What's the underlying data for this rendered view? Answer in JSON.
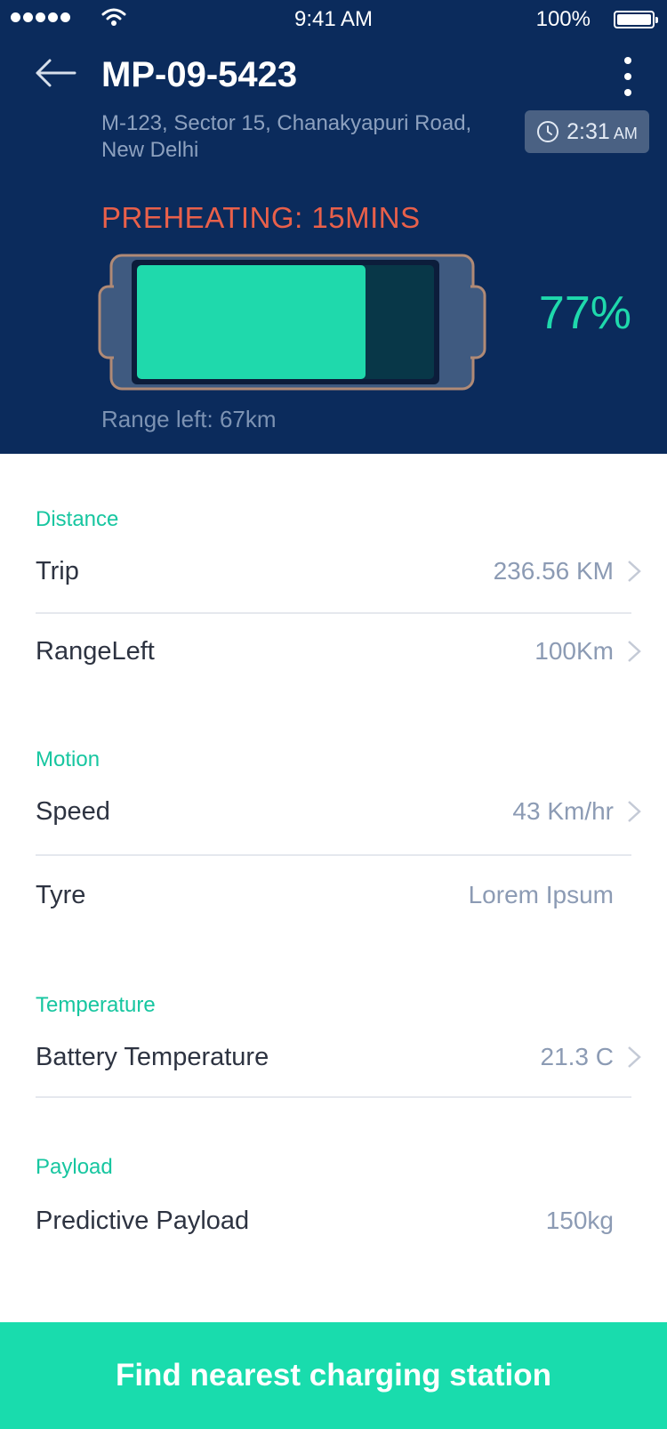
{
  "status_bar": {
    "time": "9:41 AM",
    "battery": "100%"
  },
  "header": {
    "vehicle_id": "MP-09-5423",
    "address": "M-123, Sector 15, Chanakyapuri Road, New Delhi",
    "time_chip": {
      "time": "2:31",
      "ampm": "AM"
    },
    "preheating": "PREHEATING: 15MINS",
    "charge_percent": "77%",
    "charge_level_fraction": 0.77,
    "range_left": "Range left: 67km"
  },
  "sections": {
    "distance": {
      "title": "Distance",
      "trip": {
        "label": "Trip",
        "value": "236.56 KM"
      },
      "range": {
        "label": "RangeLeft",
        "value": "100Km"
      }
    },
    "motion": {
      "title": "Motion",
      "speed": {
        "label": "Speed",
        "value": "43 Km/hr"
      },
      "tyre": {
        "label": "Tyre",
        "value": "Lorem Ipsum"
      }
    },
    "temperature": {
      "title": "Temperature",
      "battery": {
        "label": "Battery Temperature",
        "value": "21.3 C"
      }
    },
    "payload": {
      "title": "Payload",
      "predictive": {
        "label": "Predictive Payload",
        "value": "150kg"
      }
    }
  },
  "cta": {
    "label": "Find nearest charging station"
  },
  "colors": {
    "header_bg": "#0b2b5c",
    "accent_green": "#19dcad",
    "alert_orange": "#e9604a",
    "battery_fill": "#1fd9ac"
  },
  "icons": {
    "back": "arrow-left-icon",
    "more": "more-vertical-icon",
    "clock": "clock-icon",
    "chevron": "chevron-right-icon"
  }
}
